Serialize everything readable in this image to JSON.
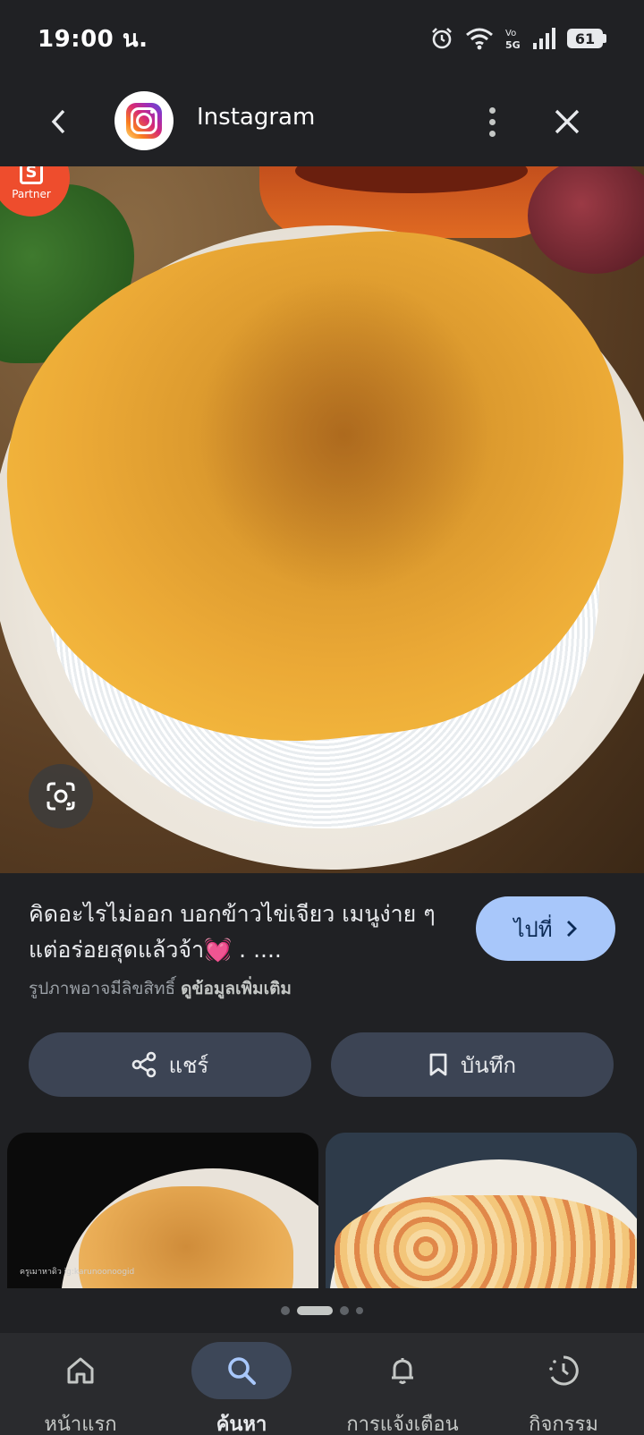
{
  "status_bar": {
    "time": "19:00 น.",
    "battery": "61",
    "network_label": "Vo 5G"
  },
  "header": {
    "title": "Instagram",
    "app_icon": "instagram-logo"
  },
  "image": {
    "badge_label": "Partner",
    "badge_letter": "S"
  },
  "result": {
    "caption": "คิดอะไรไม่ออก บอกข้าวไข่เจียว เมนูง่าย ๆ แต่อร่อยสุดแล้วจ้า💓 . ....",
    "go_label": "ไปที่",
    "rights_text": "รูปภาพอาจมีลิขสิทธิ์",
    "more_info": "ดูข้อมูลเพิ่มเติม"
  },
  "actions": {
    "share_label": "แชร์",
    "save_label": "บันทึก"
  },
  "related": {
    "thumb1_watermark": "ครูเมาหาดิว ig:karunoonoogid"
  },
  "pagination": {
    "count": 4,
    "active": 1
  },
  "bottom_nav": {
    "items": [
      {
        "label": "หน้าแรก",
        "icon": "home-icon"
      },
      {
        "label": "ค้นหา",
        "icon": "search-icon"
      },
      {
        "label": "การแจ้งเตือน",
        "icon": "bell-icon"
      },
      {
        "label": "กิจกรรม",
        "icon": "activity-icon"
      }
    ],
    "active_index": 1
  },
  "colors": {
    "background": "#202124",
    "accent_button": "#a8c7fa",
    "action_button": "#3c4454",
    "nav_bar": "#2a2b2e"
  }
}
